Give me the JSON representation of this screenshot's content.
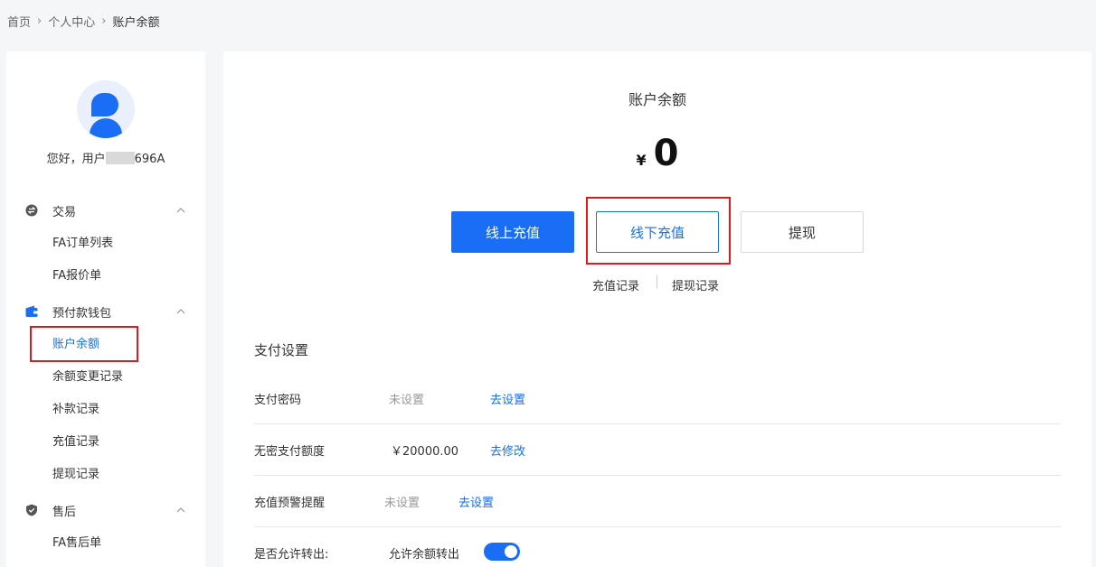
{
  "breadcrumb": {
    "items": [
      "首页",
      "个人中心",
      "账户余额"
    ],
    "separator": "›"
  },
  "user": {
    "greeting_prefix": "您好，用户",
    "greeting_suffix": "696A"
  },
  "sidebar": {
    "groups": [
      {
        "label": "交易",
        "icon": "transaction-icon",
        "items": [
          "FA订单列表",
          "FA报价单"
        ]
      },
      {
        "label": "预付款钱包",
        "icon": "wallet-icon",
        "items": [
          "账户余额",
          "余额变更记录",
          "补款记录",
          "充值记录",
          "提现记录"
        ]
      },
      {
        "label": "售后",
        "icon": "shield-icon",
        "items": [
          "FA售后单"
        ]
      }
    ],
    "active_item": "账户余额"
  },
  "balance": {
    "title": "账户余额",
    "currency": "¥",
    "amount": "0"
  },
  "actions": {
    "online_recharge": "线上充值",
    "offline_recharge": "线下充值",
    "withdraw": "提现",
    "recharge_records": "充值记录",
    "withdraw_records": "提现记录"
  },
  "payment_settings": {
    "title": "支付设置",
    "rows": [
      {
        "label": "支付密码",
        "value": "未设置",
        "action": "去设置"
      },
      {
        "label": "无密支付额度",
        "value": "￥20000.00",
        "action": "去修改"
      },
      {
        "label": "充值预警提醒",
        "value": "未设置",
        "action": "去设置"
      },
      {
        "label": "是否允许转出:",
        "value": "允许余额转出",
        "toggle_on": true
      }
    ]
  },
  "colors": {
    "primary": "#1a6ef5",
    "highlight": "#e0191f"
  }
}
